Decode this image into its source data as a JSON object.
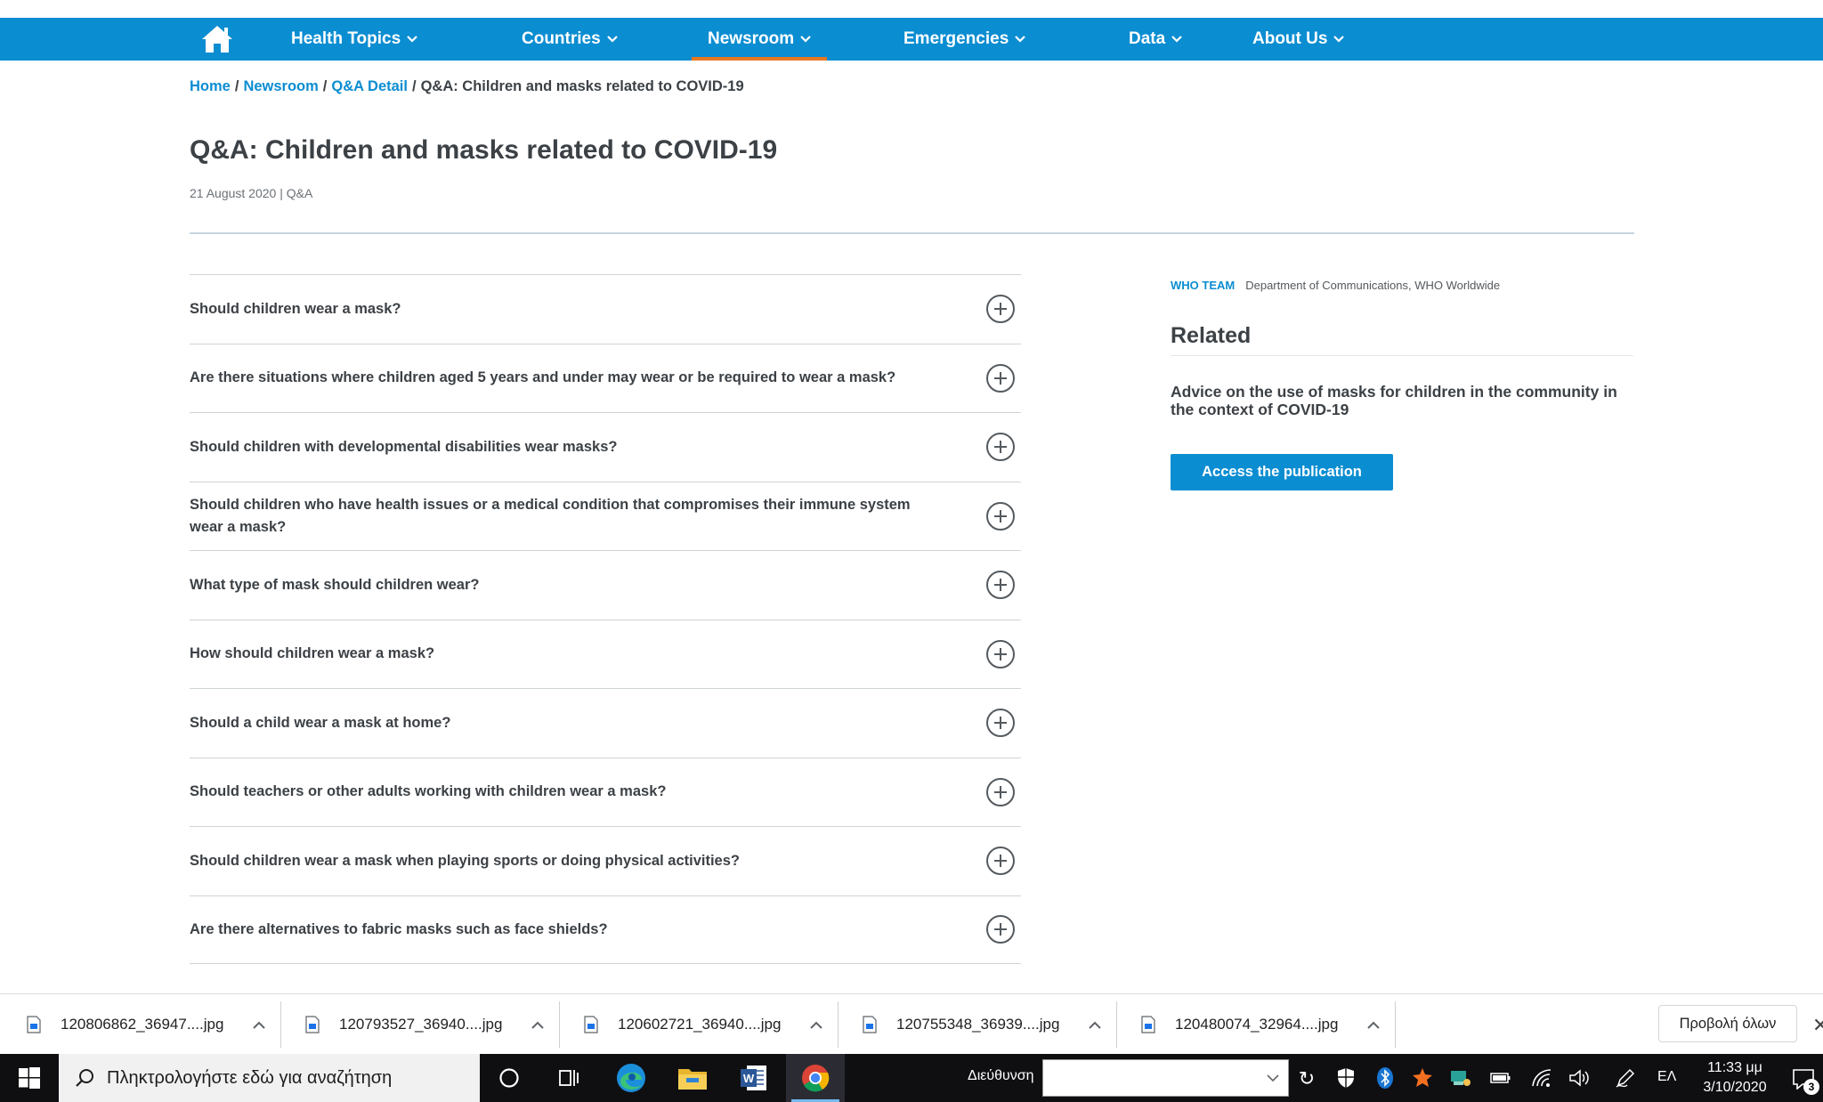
{
  "nav": {
    "items": [
      {
        "label": "Health Topics"
      },
      {
        "label": "Countries"
      },
      {
        "label": "Newsroom",
        "active": true
      },
      {
        "label": "Emergencies"
      },
      {
        "label": "Data"
      },
      {
        "label": "About Us"
      }
    ],
    "accent_color": "#0b8dd1",
    "active_underline_color": "#e87722"
  },
  "breadcrumb": {
    "items": [
      "Home",
      "Newsroom",
      "Q&A Detail"
    ],
    "separator": "/",
    "current": "Q&A: Children and masks related to COVID-19"
  },
  "article": {
    "title": "Q&A: Children and masks related to COVID-19",
    "meta": "21 August 2020 | Q&A"
  },
  "faq": {
    "questions": [
      "Should children wear a mask?",
      "Are there situations where children aged 5 years and under may wear or be required to wear a mask?",
      "Should children with developmental disabilities wear masks?",
      "Should children who have health issues or a medical condition that compromises their immune system wear a mask?",
      "What type of mask should children wear?",
      "How should children wear a mask?",
      "Should a child wear a mask at home?",
      "Should teachers or other adults working with children wear a mask?",
      "Should children wear a mask when playing sports or doing physical activities?",
      "Are there alternatives to fabric masks such as face shields?"
    ]
  },
  "sidebar": {
    "team_label": "WHO TEAM",
    "team_value": "Department of Communications, WHO Worldwide",
    "related_heading": "Related",
    "related_link": "Advice on the use of masks for children in the community in the context of COVID-19",
    "access_button": "Access the publication"
  },
  "downloads": {
    "files": [
      "120806862_36947....jpg",
      "120793527_36940....jpg",
      "120602721_36940....jpg",
      "120755348_36939....jpg",
      "120480074_32964....jpg"
    ],
    "show_all": "Προβολή όλων"
  },
  "taskbar": {
    "search_placeholder": "Πληκτρολογήστε εδώ για αναζήτηση",
    "address_label": "Διεύθυνση",
    "language": "ΕΛ",
    "time": "11:33 μμ",
    "date": "3/10/2020",
    "notification_count": "3",
    "pinned_icons": [
      "cortana-icon",
      "task-view-icon",
      "edge-icon",
      "file-explorer-icon",
      "word-icon",
      "chrome-icon"
    ],
    "tray_icons": [
      "windows-security-icon",
      "bluetooth-icon",
      "avast-icon",
      "network-adapter-icon",
      "battery-icon",
      "wifi-icon",
      "volume-icon",
      "pen-icon"
    ]
  }
}
